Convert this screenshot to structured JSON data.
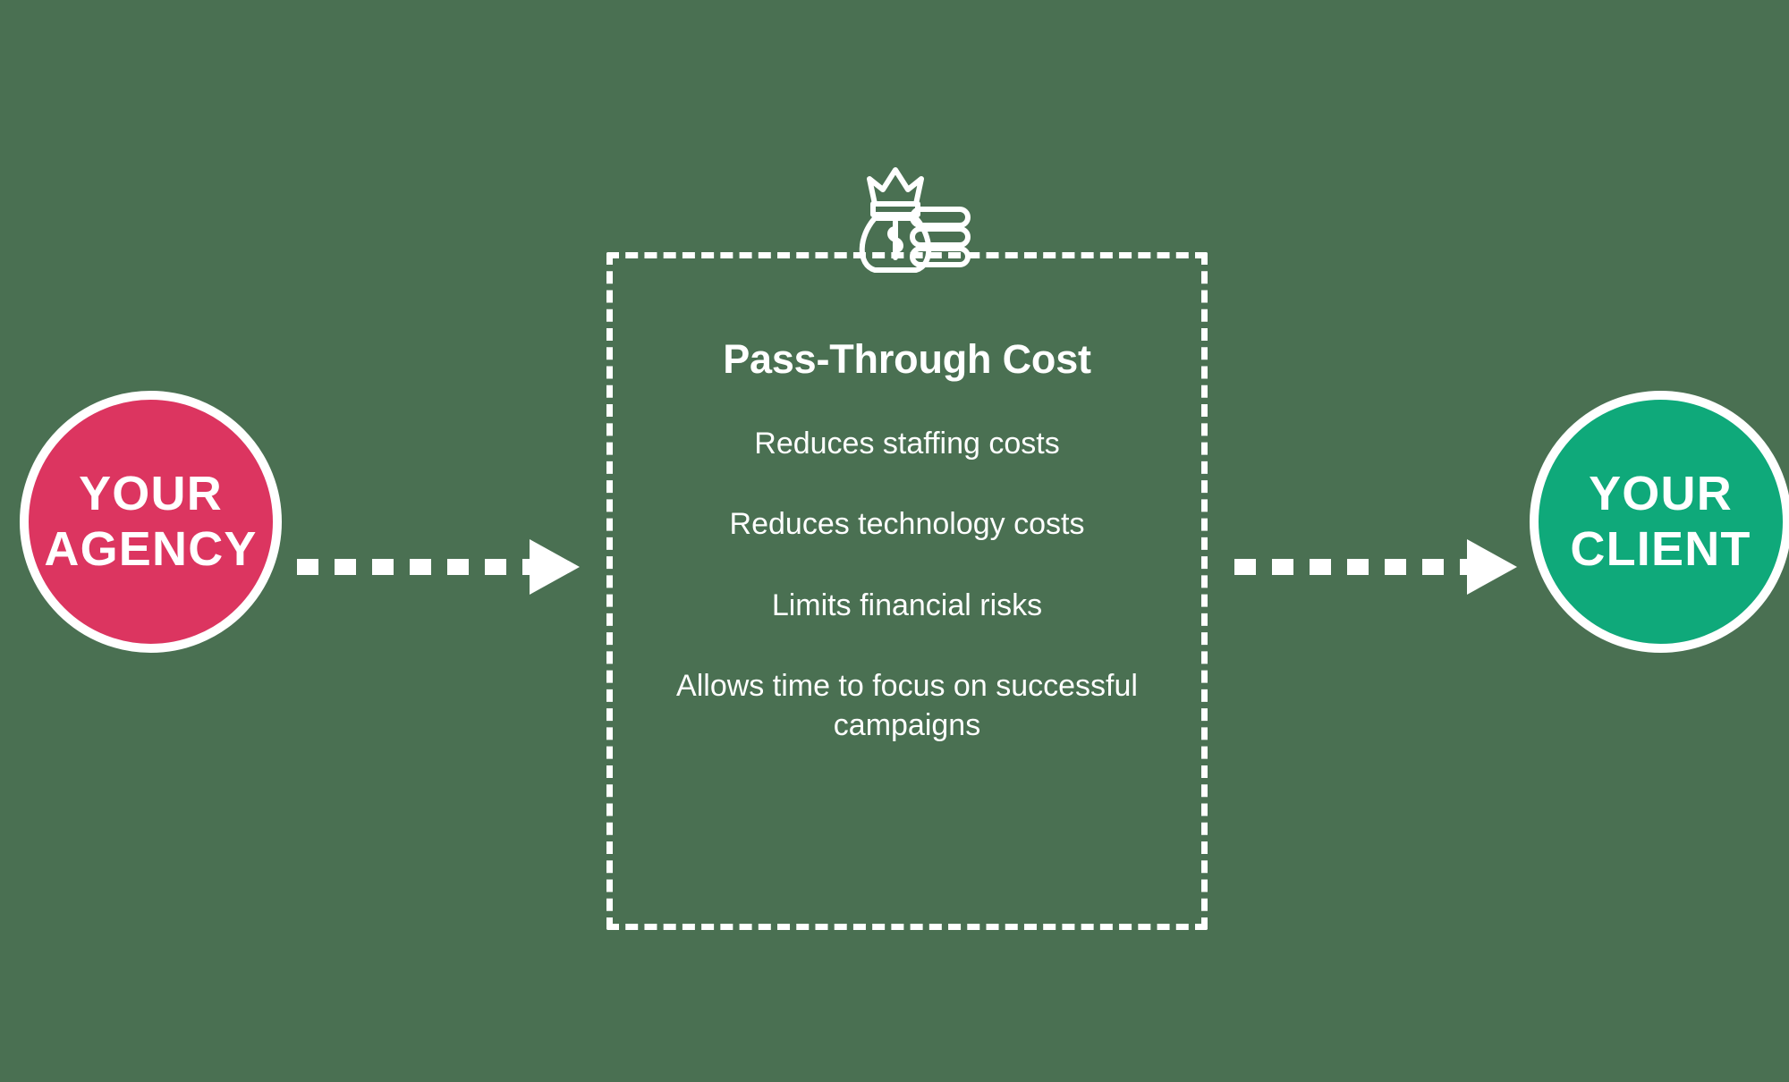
{
  "colors": {
    "background": "#4a7052",
    "agency_circle": "#dc3560",
    "client_circle": "#0fa97a",
    "text": "#ffffff",
    "panel_border": "#ffffff",
    "arrow": "#ffffff"
  },
  "nodes": {
    "agency": {
      "line1": "YOUR",
      "line2": "AGENCY"
    },
    "client": {
      "line1": "YOUR",
      "line2": "CLIENT"
    }
  },
  "panel": {
    "title": "Pass-Through Cost",
    "icon": "money-bag-coins-icon",
    "benefits": [
      "Reduces staffing costs",
      "Reduces technology costs",
      "Limits financial risks",
      "Allows time to focus on successful campaigns"
    ]
  },
  "arrows": [
    {
      "name": "agency-to-panel",
      "direction": "right",
      "style": "dashed-with-solid-head"
    },
    {
      "name": "panel-to-client",
      "direction": "right",
      "style": "dashed-with-solid-head"
    }
  ],
  "chart_data": {
    "type": "diagram",
    "title": "Pass-Through Cost",
    "flow": [
      "YOUR AGENCY",
      "Pass-Through Cost",
      "YOUR CLIENT"
    ],
    "nodes": [
      {
        "id": "agency",
        "label": "YOUR AGENCY",
        "shape": "circle",
        "color": "#dc3560"
      },
      {
        "id": "passthrough",
        "label": "Pass-Through Cost",
        "shape": "dashed-rectangle",
        "color": "#ffffff"
      },
      {
        "id": "client",
        "label": "YOUR CLIENT",
        "shape": "circle",
        "color": "#0fa97a"
      }
    ],
    "edges": [
      {
        "from": "agency",
        "to": "passthrough",
        "style": "dashed-arrow"
      },
      {
        "from": "passthrough",
        "to": "client",
        "style": "dashed-arrow"
      }
    ],
    "annotations": [
      "Reduces staffing costs",
      "Reduces technology costs",
      "Limits financial risks",
      "Allows time to focus on successful campaigns"
    ]
  }
}
